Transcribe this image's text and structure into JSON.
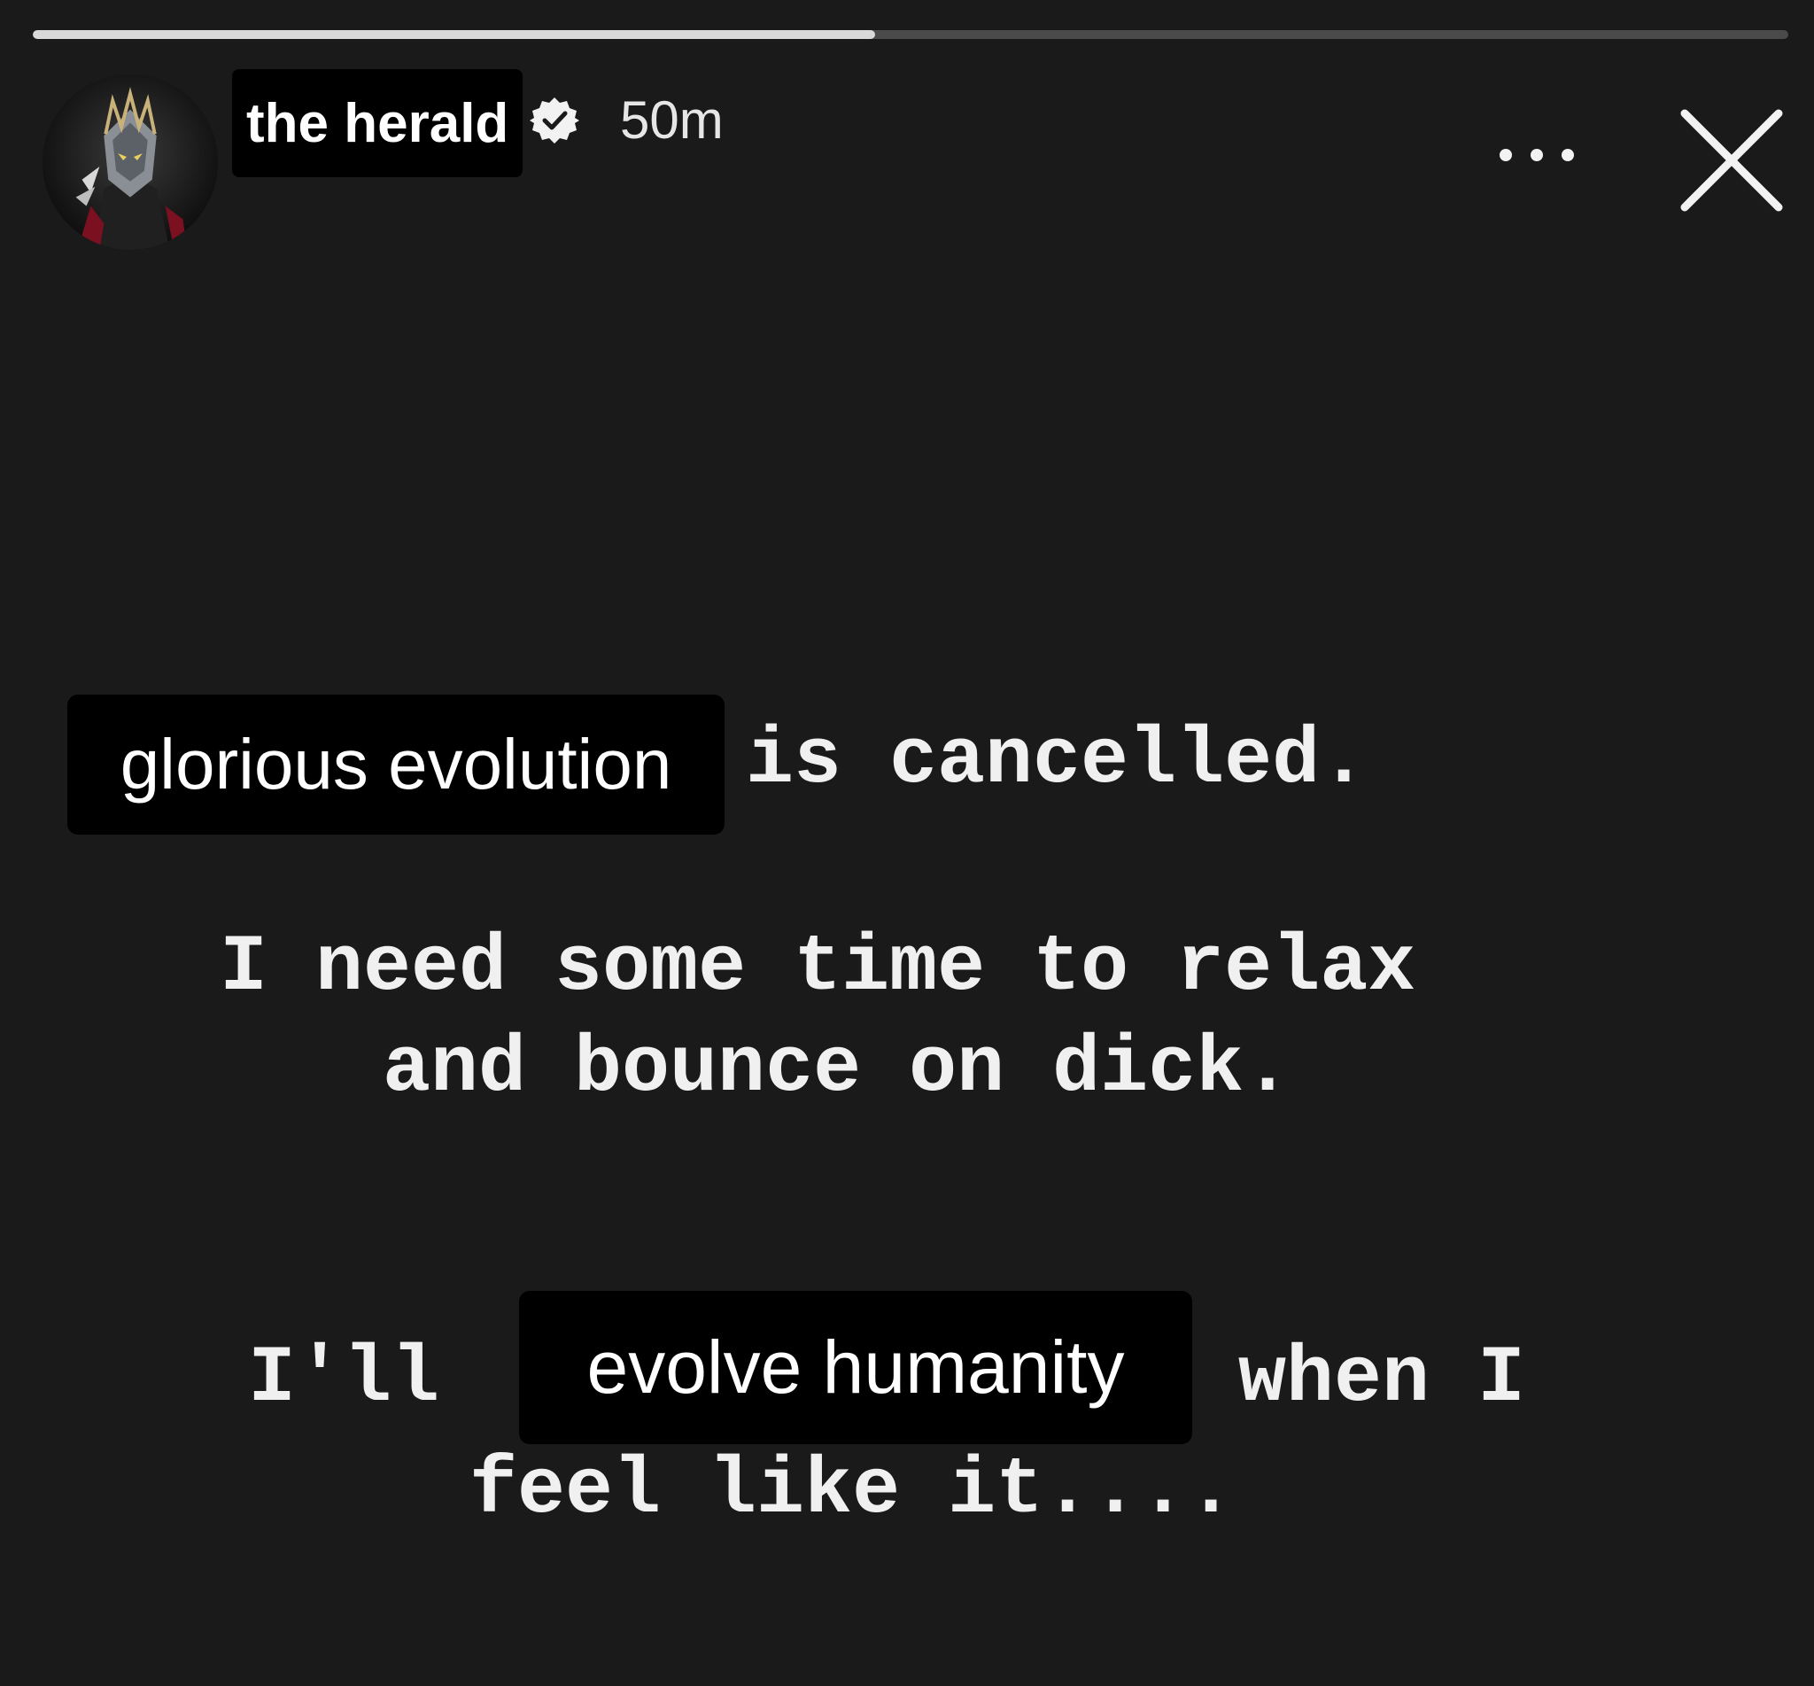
{
  "story": {
    "progress": 0.48,
    "user": {
      "name": "the herald",
      "verified": true,
      "time_ago": "50m"
    },
    "controls": {
      "more_icon": "more-horizontal-icon",
      "close_icon": "close-icon"
    },
    "text": {
      "sticker_1": "glorious evolution",
      "line_1": "is cancelled.",
      "line_2": "I need some time to relax",
      "line_3": "and bounce on dick.",
      "line_4_prefix": "I'll",
      "sticker_2": "evolve humanity",
      "line_4_suffix": "when I",
      "line_5": "feel like it...."
    }
  }
}
